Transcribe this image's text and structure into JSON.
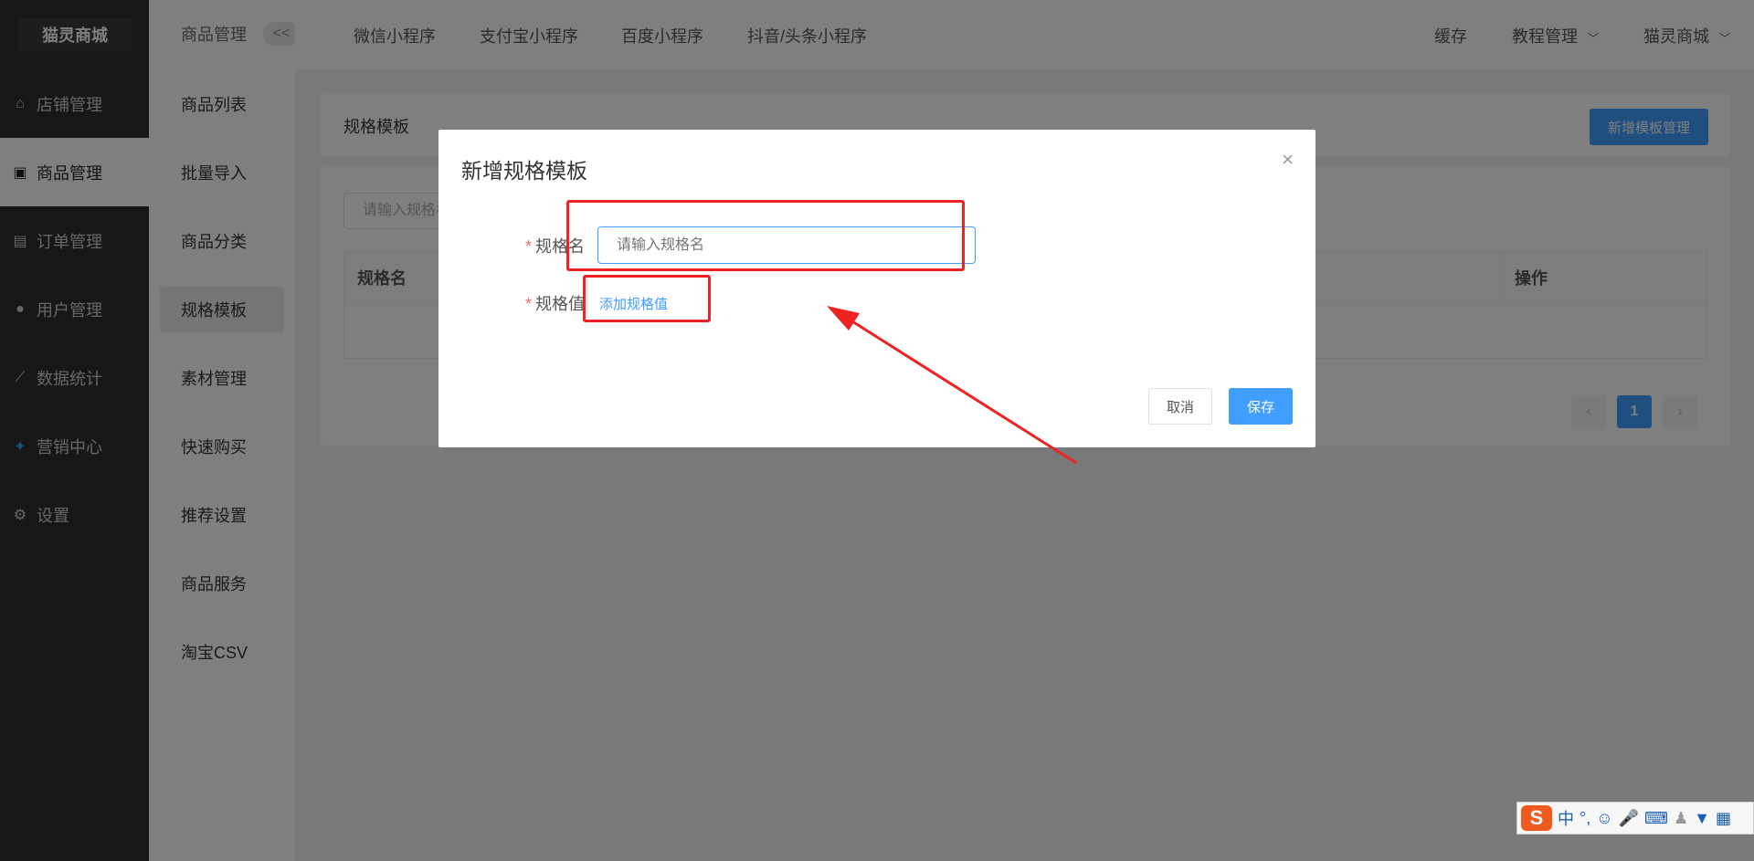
{
  "logo": "猫灵商城",
  "sidebar_main": [
    {
      "label": "店铺管理",
      "icon": "store-icon"
    },
    {
      "label": "商品管理",
      "icon": "goods-icon"
    },
    {
      "label": "订单管理",
      "icon": "order-icon"
    },
    {
      "label": "用户管理",
      "icon": "user-icon"
    },
    {
      "label": "数据统计",
      "icon": "chart-icon"
    },
    {
      "label": "营销中心",
      "icon": "marketing-icon"
    },
    {
      "label": "设置",
      "icon": "settings-icon"
    }
  ],
  "sidebar_sub": {
    "title": "商品管理",
    "collapse_label": "<<",
    "items": [
      "商品列表",
      "批量导入",
      "商品分类",
      "规格模板",
      "素材管理",
      "快速购买",
      "推荐设置",
      "商品服务",
      "淘宝CSV"
    ]
  },
  "topnav": {
    "tabs": [
      "微信小程序",
      "支付宝小程序",
      "百度小程序",
      "抖音/头条小程序"
    ],
    "cache": "缓存",
    "tutorial": "教程管理",
    "shop": "猫灵商城"
  },
  "page": {
    "title": "规格模板",
    "new_button": "新增模板管理",
    "search_placeholder": "请输入规格名",
    "columns": [
      "规格名",
      "操作"
    ],
    "current_page": "1"
  },
  "dialog": {
    "title": "新增规格模板",
    "close": "×",
    "name_label": "规格名",
    "name_placeholder": "请输入规格名",
    "value_label": "规格值",
    "add_value_link": "添加规格值",
    "cancel": "取消",
    "save": "保存",
    "required_mark": "*"
  },
  "ime": {
    "logo": "S",
    "mode": "中",
    "punct": "°,"
  },
  "colors": {
    "accent": "#409eff",
    "annotation": "#ee2222",
    "sidebar_bg": "#2f2f2f"
  }
}
